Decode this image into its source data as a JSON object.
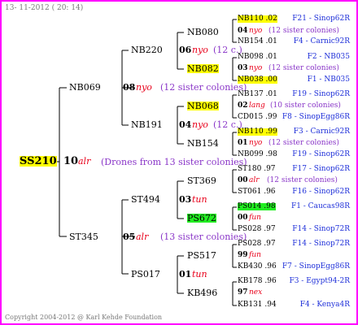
{
  "header": {
    "date": "13- 11-2012 ( 20: 14)"
  },
  "footer": {
    "copyright": "Copyright 2004-2012 @ Karl Kehde Foundation"
  },
  "root": {
    "name": "SS210",
    "num": "10",
    "mark": "alr",
    "note": "(Drones from 13 sister colonies)"
  },
  "gen1": [
    {
      "name": "NB069",
      "num": "08",
      "mark": "nyo",
      "note": "(12 sister colonies)"
    },
    {
      "name": "ST345",
      "num": "05",
      "mark": "alr",
      "note": "(13 sister colonies)"
    }
  ],
  "gen2": [
    {
      "name": "NB220",
      "num": "06",
      "mark": "nyo",
      "note": "(12 c.)"
    },
    {
      "name": "NB191",
      "num": "04",
      "mark": "nyo",
      "note": "(12 c.)"
    },
    {
      "name": "ST494",
      "num": "03",
      "mark": "tun",
      "note": ""
    },
    {
      "name": "PS017",
      "num": "01",
      "mark": "tun",
      "note": ""
    }
  ],
  "gen3": [
    {
      "name": "NB080",
      "num": "04",
      "mark": "nyo",
      "note": "(12 sister colonies)"
    },
    {
      "name": "NB082",
      "num": "03",
      "mark": "nyo",
      "note": "(12 sister colonies)"
    },
    {
      "name": "NB068",
      "num": "02",
      "mark": "lang",
      "note": "(10 sister colonies)"
    },
    {
      "name": "NB154",
      "num": "01",
      "mark": "nyo",
      "note": "(12 sister colonies)"
    },
    {
      "name": "ST369",
      "num": "00",
      "mark": "alr",
      "note": "(12 sister colonies)"
    },
    {
      "name": "PS672",
      "num": "00",
      "mark": "fun",
      "note": ""
    },
    {
      "name": "PS517",
      "num": "99",
      "mark": "fun",
      "note": ""
    },
    {
      "name": "KB496",
      "num": "97",
      "mark": "nex",
      "note": ""
    }
  ],
  "gen4": [
    {
      "id": "NB110 .02",
      "info": "F21 - Sinop62R"
    },
    {
      "id": "NB154 .01",
      "info": "F4 - Carnic92R"
    },
    {
      "id": "NB098 .01",
      "info": "F2 - NB035"
    },
    {
      "id": "NB038 .00",
      "info": "F1 - NB035"
    },
    {
      "id": "NB137 .01",
      "info": "F19 - Sinop62R"
    },
    {
      "id": "CD015 .99",
      "info": "F8 - SinopEgg86R"
    },
    {
      "id": "NB110 .99",
      "info": "F3 - Carnic92R"
    },
    {
      "id": "NB099 .98",
      "info": "F19 - Sinop62R"
    },
    {
      "id": "ST180 .97",
      "info": "F17 - Sinop62R"
    },
    {
      "id": "ST061 .96",
      "info": "F16 - Sinop62R"
    },
    {
      "id": "PS014 .98",
      "info": "F1 - Caucas98R"
    },
    {
      "id": "PS028 .97",
      "info": "F14 - Sinop72R"
    },
    {
      "id": "PS028 .97",
      "info": "F14 - Sinop72R"
    },
    {
      "id": "KB430 .96",
      "info": "F7 - SinopEgg86R"
    },
    {
      "id": "KB178 .96",
      "info": "F3 - Egypt94-2R"
    },
    {
      "id": "KB131 .94",
      "info": "F4 - Kenya4R"
    }
  ],
  "colors": {
    "frame": "#ff00ff",
    "highlight_yellow": "#ffff00",
    "highlight_green": "#22ee22",
    "mark_red": "#e8001a",
    "info_blue": "#1e2fd9",
    "note_purple": "#8a36c8"
  }
}
